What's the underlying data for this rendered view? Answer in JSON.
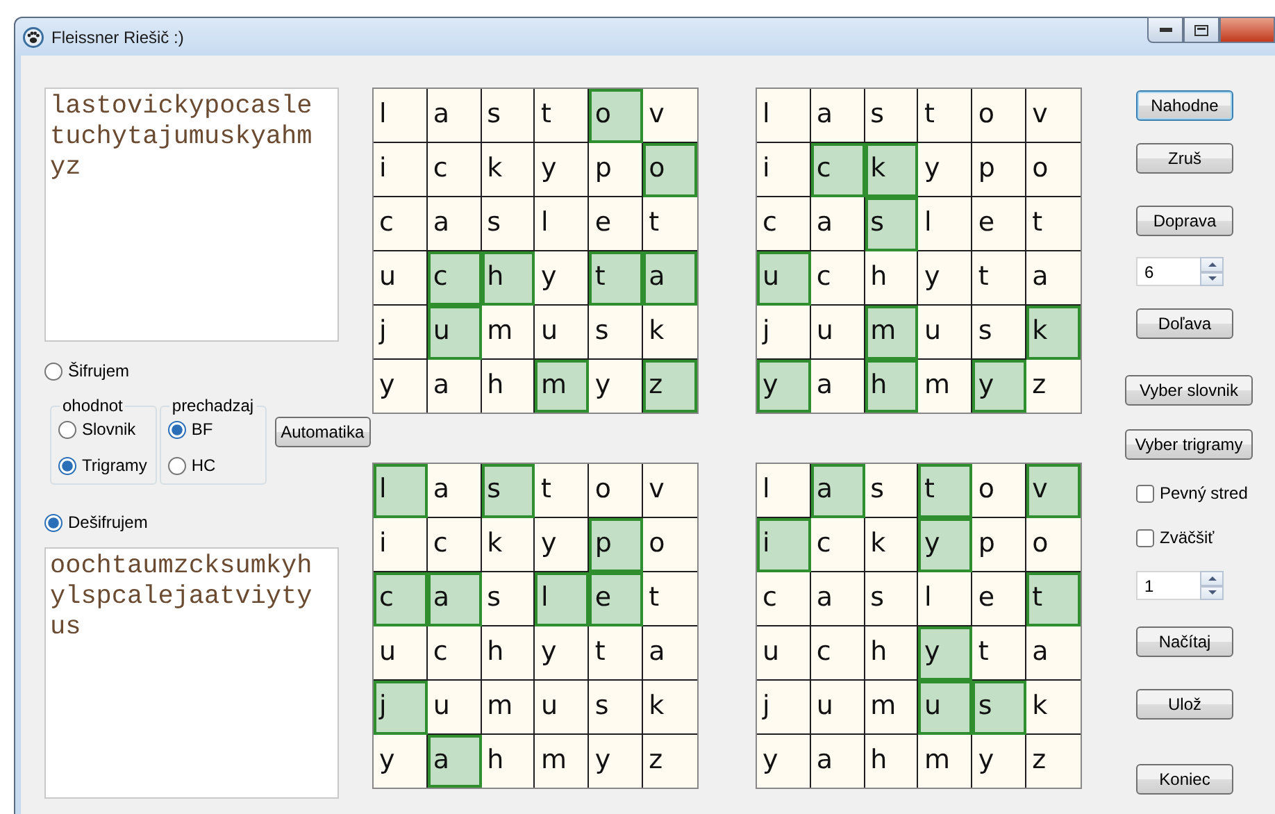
{
  "window": {
    "title": "Fleissner Riešič :)"
  },
  "input": {
    "text": "lastovickypocasletuchytajumuskyahmyz"
  },
  "mode_encrypt": {
    "label": "Šifrujem",
    "selected": false
  },
  "groups": [
    {
      "title": "ohodnot",
      "options": [
        {
          "label": "Slovnik",
          "selected": false
        },
        {
          "label": "Trigramy",
          "selected": true
        }
      ]
    },
    {
      "title": "prechadzaj",
      "options": [
        {
          "label": "BF",
          "selected": true
        },
        {
          "label": "HC",
          "selected": false
        }
      ]
    }
  ],
  "automatika_button": {
    "label": "Automatika"
  },
  "mode_decrypt": {
    "label": "Dešifrujem",
    "selected": true
  },
  "output": {
    "text": "oochtaumzcksumkyhylspcalejaatviytyus"
  },
  "grids": [
    {
      "rows": [
        [
          {
            "letter": "l",
            "selected": false
          },
          {
            "letter": "a",
            "selected": false
          },
          {
            "letter": "s",
            "selected": false
          },
          {
            "letter": "t",
            "selected": false
          },
          {
            "letter": "o",
            "selected": true
          },
          {
            "letter": "v",
            "selected": false
          }
        ],
        [
          {
            "letter": "i",
            "selected": false
          },
          {
            "letter": "c",
            "selected": false
          },
          {
            "letter": "k",
            "selected": false
          },
          {
            "letter": "y",
            "selected": false
          },
          {
            "letter": "p",
            "selected": false
          },
          {
            "letter": "o",
            "selected": true
          }
        ],
        [
          {
            "letter": "c",
            "selected": false
          },
          {
            "letter": "a",
            "selected": false
          },
          {
            "letter": "s",
            "selected": false
          },
          {
            "letter": "l",
            "selected": false
          },
          {
            "letter": "e",
            "selected": false
          },
          {
            "letter": "t",
            "selected": false
          }
        ],
        [
          {
            "letter": "u",
            "selected": false
          },
          {
            "letter": "c",
            "selected": true
          },
          {
            "letter": "h",
            "selected": true
          },
          {
            "letter": "y",
            "selected": false
          },
          {
            "letter": "t",
            "selected": true
          },
          {
            "letter": "a",
            "selected": true
          }
        ],
        [
          {
            "letter": "j",
            "selected": false
          },
          {
            "letter": "u",
            "selected": true
          },
          {
            "letter": "m",
            "selected": false
          },
          {
            "letter": "u",
            "selected": false
          },
          {
            "letter": "s",
            "selected": false
          },
          {
            "letter": "k",
            "selected": false
          }
        ],
        [
          {
            "letter": "y",
            "selected": false
          },
          {
            "letter": "a",
            "selected": false
          },
          {
            "letter": "h",
            "selected": false
          },
          {
            "letter": "m",
            "selected": true
          },
          {
            "letter": "y",
            "selected": false
          },
          {
            "letter": "z",
            "selected": true
          }
        ]
      ]
    },
    {
      "rows": [
        [
          {
            "letter": "l",
            "selected": false
          },
          {
            "letter": "a",
            "selected": false
          },
          {
            "letter": "s",
            "selected": false
          },
          {
            "letter": "t",
            "selected": false
          },
          {
            "letter": "o",
            "selected": false
          },
          {
            "letter": "v",
            "selected": false
          }
        ],
        [
          {
            "letter": "i",
            "selected": false
          },
          {
            "letter": "c",
            "selected": true
          },
          {
            "letter": "k",
            "selected": true
          },
          {
            "letter": "y",
            "selected": false
          },
          {
            "letter": "p",
            "selected": false
          },
          {
            "letter": "o",
            "selected": false
          }
        ],
        [
          {
            "letter": "c",
            "selected": false
          },
          {
            "letter": "a",
            "selected": false
          },
          {
            "letter": "s",
            "selected": true
          },
          {
            "letter": "l",
            "selected": false
          },
          {
            "letter": "e",
            "selected": false
          },
          {
            "letter": "t",
            "selected": false
          }
        ],
        [
          {
            "letter": "u",
            "selected": true
          },
          {
            "letter": "c",
            "selected": false
          },
          {
            "letter": "h",
            "selected": false
          },
          {
            "letter": "y",
            "selected": false
          },
          {
            "letter": "t",
            "selected": false
          },
          {
            "letter": "a",
            "selected": false
          }
        ],
        [
          {
            "letter": "j",
            "selected": false
          },
          {
            "letter": "u",
            "selected": false
          },
          {
            "letter": "m",
            "selected": true
          },
          {
            "letter": "u",
            "selected": false
          },
          {
            "letter": "s",
            "selected": false
          },
          {
            "letter": "k",
            "selected": true
          }
        ],
        [
          {
            "letter": "y",
            "selected": true
          },
          {
            "letter": "a",
            "selected": false
          },
          {
            "letter": "h",
            "selected": true
          },
          {
            "letter": "m",
            "selected": false
          },
          {
            "letter": "y",
            "selected": true
          },
          {
            "letter": "z",
            "selected": false
          }
        ]
      ]
    },
    {
      "rows": [
        [
          {
            "letter": "l",
            "selected": true
          },
          {
            "letter": "a",
            "selected": false
          },
          {
            "letter": "s",
            "selected": true
          },
          {
            "letter": "t",
            "selected": false
          },
          {
            "letter": "o",
            "selected": false
          },
          {
            "letter": "v",
            "selected": false
          }
        ],
        [
          {
            "letter": "i",
            "selected": false
          },
          {
            "letter": "c",
            "selected": false
          },
          {
            "letter": "k",
            "selected": false
          },
          {
            "letter": "y",
            "selected": false
          },
          {
            "letter": "p",
            "selected": true
          },
          {
            "letter": "o",
            "selected": false
          }
        ],
        [
          {
            "letter": "c",
            "selected": true
          },
          {
            "letter": "a",
            "selected": true
          },
          {
            "letter": "s",
            "selected": false
          },
          {
            "letter": "l",
            "selected": true
          },
          {
            "letter": "e",
            "selected": true
          },
          {
            "letter": "t",
            "selected": false
          }
        ],
        [
          {
            "letter": "u",
            "selected": false
          },
          {
            "letter": "c",
            "selected": false
          },
          {
            "letter": "h",
            "selected": false
          },
          {
            "letter": "y",
            "selected": false
          },
          {
            "letter": "t",
            "selected": false
          },
          {
            "letter": "a",
            "selected": false
          }
        ],
        [
          {
            "letter": "j",
            "selected": true
          },
          {
            "letter": "u",
            "selected": false
          },
          {
            "letter": "m",
            "selected": false
          },
          {
            "letter": "u",
            "selected": false
          },
          {
            "letter": "s",
            "selected": false
          },
          {
            "letter": "k",
            "selected": false
          }
        ],
        [
          {
            "letter": "y",
            "selected": false
          },
          {
            "letter": "a",
            "selected": true
          },
          {
            "letter": "h",
            "selected": false
          },
          {
            "letter": "m",
            "selected": false
          },
          {
            "letter": "y",
            "selected": false
          },
          {
            "letter": "z",
            "selected": false
          }
        ]
      ]
    },
    {
      "rows": [
        [
          {
            "letter": "l",
            "selected": false
          },
          {
            "letter": "a",
            "selected": true
          },
          {
            "letter": "s",
            "selected": false
          },
          {
            "letter": "t",
            "selected": true
          },
          {
            "letter": "o",
            "selected": false
          },
          {
            "letter": "v",
            "selected": true
          }
        ],
        [
          {
            "letter": "i",
            "selected": true
          },
          {
            "letter": "c",
            "selected": false
          },
          {
            "letter": "k",
            "selected": false
          },
          {
            "letter": "y",
            "selected": true
          },
          {
            "letter": "p",
            "selected": false
          },
          {
            "letter": "o",
            "selected": false
          }
        ],
        [
          {
            "letter": "c",
            "selected": false
          },
          {
            "letter": "a",
            "selected": false
          },
          {
            "letter": "s",
            "selected": false
          },
          {
            "letter": "l",
            "selected": false
          },
          {
            "letter": "e",
            "selected": false
          },
          {
            "letter": "t",
            "selected": true
          }
        ],
        [
          {
            "letter": "u",
            "selected": false
          },
          {
            "letter": "c",
            "selected": false
          },
          {
            "letter": "h",
            "selected": false
          },
          {
            "letter": "y",
            "selected": true
          },
          {
            "letter": "t",
            "selected": false
          },
          {
            "letter": "a",
            "selected": false
          }
        ],
        [
          {
            "letter": "j",
            "selected": false
          },
          {
            "letter": "u",
            "selected": false
          },
          {
            "letter": "m",
            "selected": false
          },
          {
            "letter": "u",
            "selected": true
          },
          {
            "letter": "s",
            "selected": true
          },
          {
            "letter": "k",
            "selected": false
          }
        ],
        [
          {
            "letter": "y",
            "selected": false
          },
          {
            "letter": "a",
            "selected": false
          },
          {
            "letter": "h",
            "selected": false
          },
          {
            "letter": "m",
            "selected": false
          },
          {
            "letter": "y",
            "selected": false
          },
          {
            "letter": "z",
            "selected": false
          }
        ]
      ]
    }
  ],
  "controls": [
    {
      "kind": "button",
      "label": "Nahodne",
      "focused": true
    },
    {
      "kind": "button",
      "label": "Zruš",
      "focused": false
    },
    {
      "kind": "button",
      "label": "Doprava",
      "focused": false
    },
    {
      "kind": "spinner",
      "value": "6"
    },
    {
      "kind": "button",
      "label": "Doľava",
      "focused": false
    },
    {
      "kind": "button",
      "label": "Vyber slovnik",
      "focused": false
    },
    {
      "kind": "button",
      "label": "Vyber trigramy",
      "focused": false
    },
    {
      "kind": "checkbox",
      "label": "Pevný stred",
      "checked": false
    },
    {
      "kind": "checkbox",
      "label": "Zväčšiť",
      "checked": false
    },
    {
      "kind": "spinner",
      "value": "1"
    },
    {
      "kind": "button",
      "label": "Načítaj",
      "focused": false
    },
    {
      "kind": "button",
      "label": "Ulož",
      "focused": false
    },
    {
      "kind": "button",
      "label": "Koniec",
      "focused": false
    }
  ]
}
